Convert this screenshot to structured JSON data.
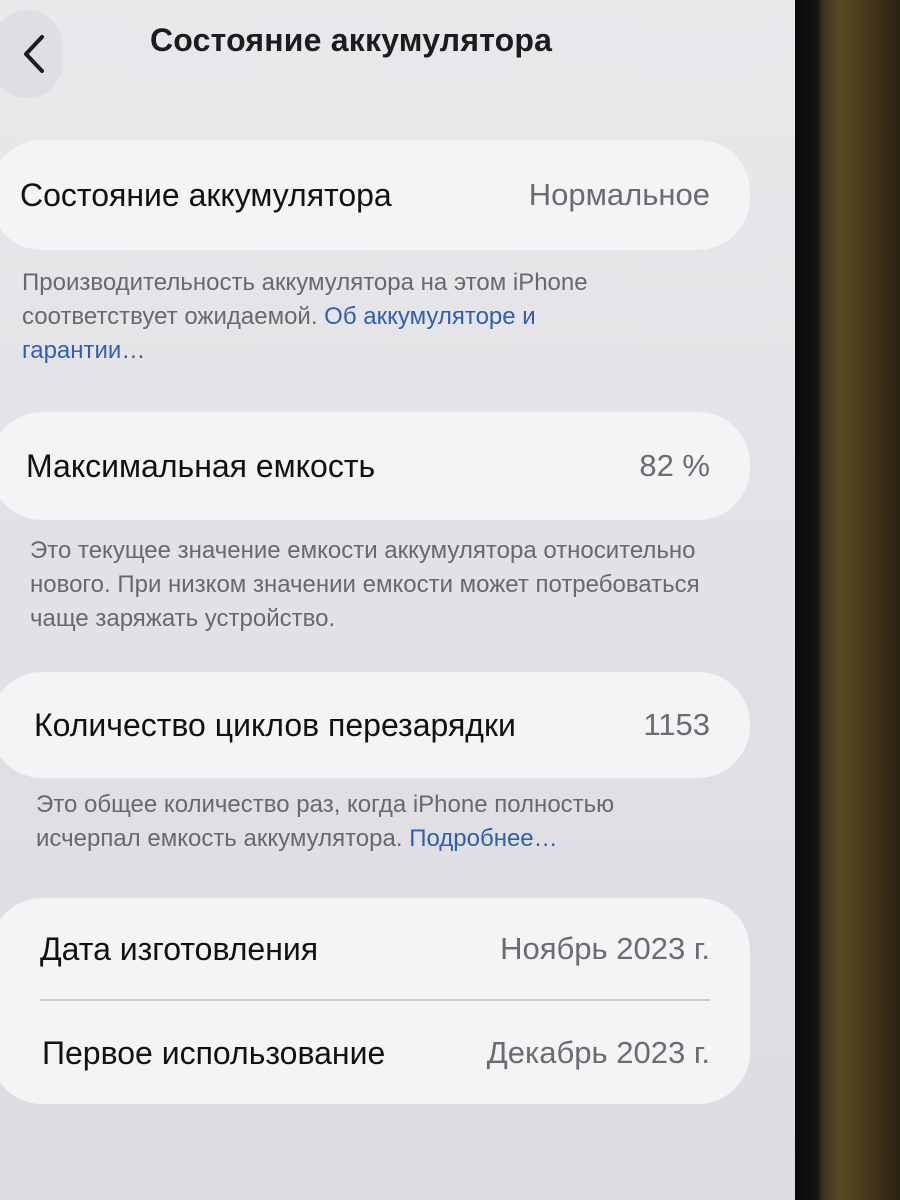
{
  "nav": {
    "title": "Состояние аккумулятора"
  },
  "health": {
    "label": "Состояние аккумулятора",
    "value": "Нормальное",
    "note": "Производительность аккумулятора на этом iPhone соответствует ожидаемой.",
    "link": "Об аккумуляторе и гарантии…"
  },
  "capacity": {
    "label": "Максимальная емкость",
    "value": "82 %",
    "note": "Это текущее значение емкости аккумулятора относительно нового. При низком значении емкости может потребоваться чаще заряжать устройство."
  },
  "cycles": {
    "label": "Количество циклов перезарядки",
    "value": "1153",
    "note": "Это общее количество раз, когда iPhone полностью исчерпал емкость аккумулятора.",
    "link": "Подробнее…"
  },
  "dates": {
    "manufacture_label": "Дата изготовления",
    "manufacture_value": "Ноябрь 2023 г.",
    "first_use_label": "Первое использование",
    "first_use_value": "Декабрь 2023 г."
  },
  "colors": {
    "background": "#e6e6ea",
    "card": "#f4f4f6",
    "label": "#111113",
    "value": "#6b6b70",
    "link": "#2e5fb0"
  },
  "icons": {
    "back": "chevron-left-icon"
  }
}
